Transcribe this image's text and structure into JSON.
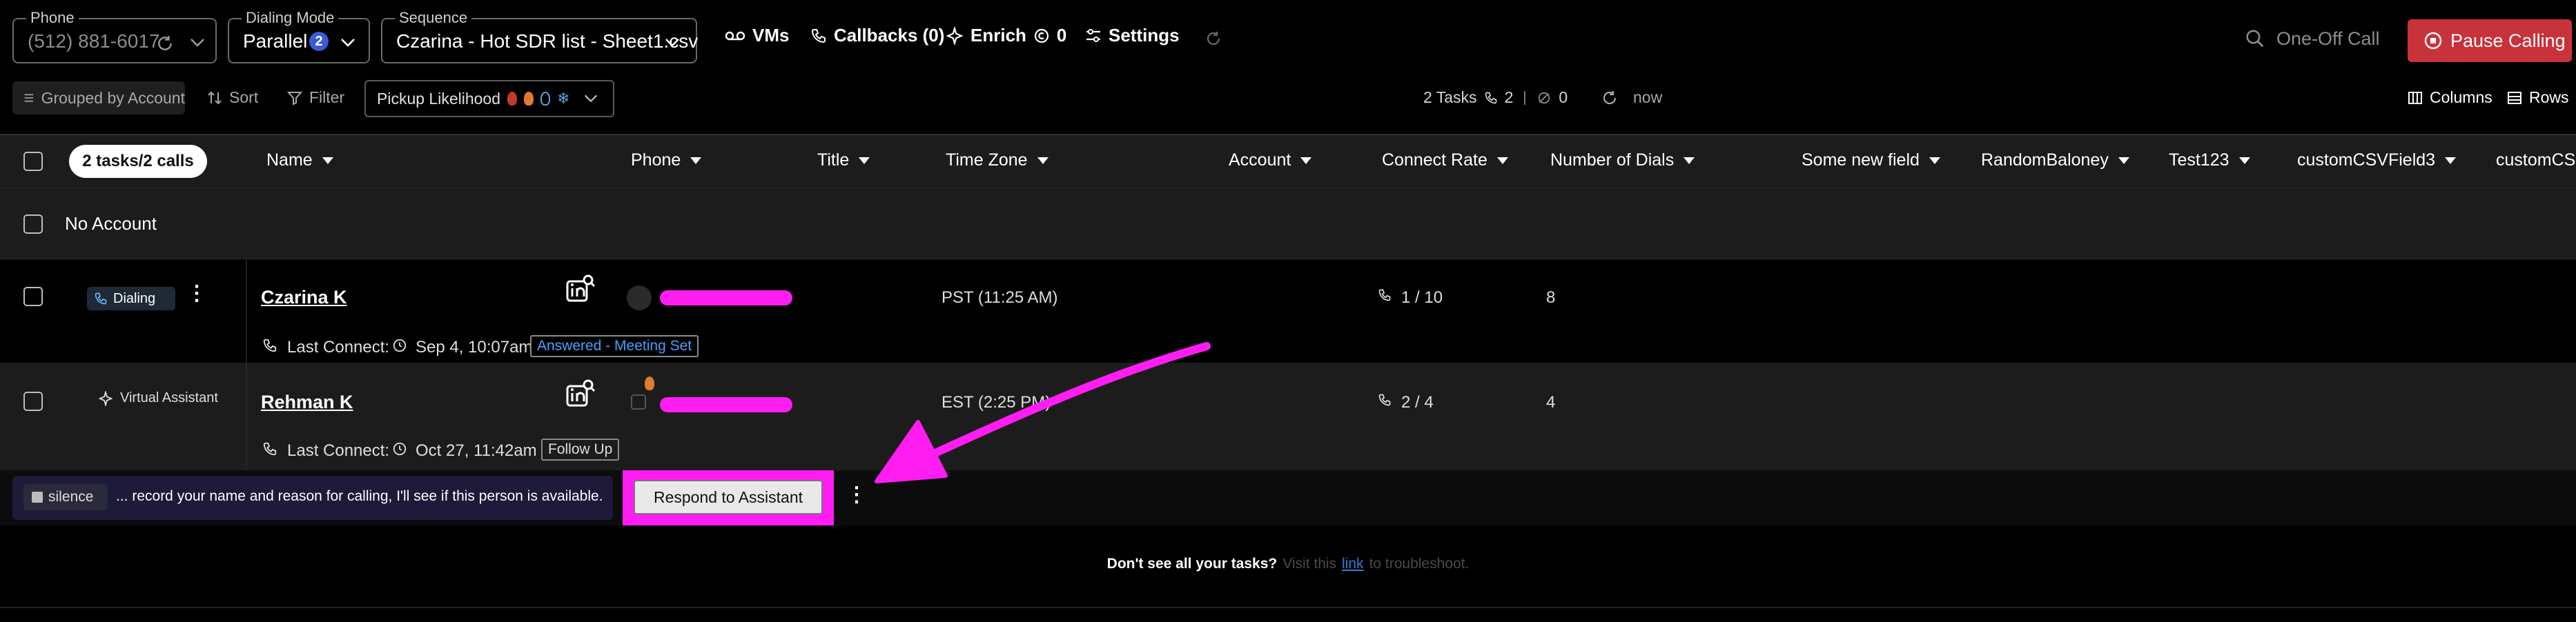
{
  "toolbar": {
    "phone_legend": "Phone",
    "phone_value": "(512) 881-6017",
    "mode_legend": "Dialing Mode",
    "mode_value": "Parallel",
    "mode_count": "2",
    "sequence_legend": "Sequence",
    "sequence_value": "Czarina - Hot SDR list - Sheet1.csv",
    "vms_label": "VMs",
    "callbacks_label": "Callbacks (0)",
    "enrich_label": "Enrich",
    "enrich_count": "0",
    "settings_label": "Settings",
    "search_placeholder": "One-Off Call",
    "pause_label": "Pause Calling"
  },
  "filters": {
    "grouped_label": "Grouped by Account",
    "sort_label": "Sort",
    "filter_label": "Filter",
    "pickup_label": "Pickup Likelihood",
    "tasks_label": "2 Tasks",
    "calls_count": "2",
    "skipped_count": "0",
    "refresh_label": "now",
    "columns_label": "Columns",
    "rows_label": "Rows"
  },
  "table": {
    "tasks_pill": "2 tasks/2 calls",
    "columns": [
      "Name",
      "Phone",
      "Title",
      "Time Zone",
      "Account",
      "Connect Rate",
      "Number of Dials",
      "Some new field",
      "RandomBaloney",
      "Test123",
      "customCSVField3",
      "customCS"
    ],
    "group_label": "No Account"
  },
  "rows": [
    {
      "status": "Dialing",
      "name": "Czarina K",
      "timezone": "PST (11:25 AM)",
      "connect_rate": "1 / 10",
      "dials": "8",
      "last_connect_label": "Last Connect:",
      "last_connect_date": "Sep 4, 10:07am",
      "outcome": "Answered - Meeting Set"
    },
    {
      "status": "Virtual Assistant",
      "name": "Rehman K",
      "timezone": "EST (2:25 PM)",
      "connect_rate": "2 / 4",
      "dials": "4",
      "last_connect_label": "Last Connect:",
      "last_connect_date": "Oct 27, 11:42am",
      "outcome": "Follow Up"
    }
  ],
  "assistant": {
    "silence_label": "silence",
    "transcript": "... record your name and reason for calling, I'll see if this person is available.",
    "respond_label": "Respond to Assistant"
  },
  "footer": {
    "question": "Don't see all your tasks?",
    "pre_link": "Visit this",
    "link": "link",
    "post_link": "to troubleshoot."
  },
  "colors": {
    "accent_pink": "#ff1df2",
    "pause_red": "#c8323a",
    "badge_blue": "#4a9fff"
  }
}
